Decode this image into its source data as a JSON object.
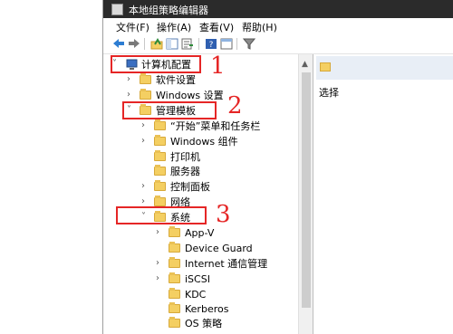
{
  "window": {
    "title": "本地组策略编辑器"
  },
  "menu": [
    {
      "label": "文件(F)"
    },
    {
      "label": "操作(A)"
    },
    {
      "label": "查看(V)"
    },
    {
      "label": "帮助(H)"
    }
  ],
  "toolbar": {
    "icons": [
      "back-arrow-icon",
      "forward-arrow-icon",
      "up-folder-icon",
      "show-hide-tree-icon",
      "export-list-icon",
      "help-icon",
      "properties-icon",
      "filter-icon"
    ]
  },
  "tree": {
    "nodes": [
      {
        "label": "计算机配置",
        "chevron": "down",
        "icon": "computer-icon"
      },
      {
        "label": "软件设置",
        "chevron": "right",
        "icon": "folder-icon"
      },
      {
        "label": "Windows 设置",
        "chevron": "right",
        "icon": "folder-icon"
      },
      {
        "label": "管理模板",
        "chevron": "down",
        "icon": "folder-icon"
      },
      {
        "label": "“开始”菜单和任务栏",
        "chevron": "right",
        "icon": "folder-icon"
      },
      {
        "label": "Windows 组件",
        "chevron": "right",
        "icon": "folder-icon"
      },
      {
        "label": "打印机",
        "chevron": "",
        "icon": "folder-icon"
      },
      {
        "label": "服务器",
        "chevron": "",
        "icon": "folder-icon"
      },
      {
        "label": "控制面板",
        "chevron": "right",
        "icon": "folder-icon"
      },
      {
        "label": "网络",
        "chevron": "right",
        "icon": "folder-icon"
      },
      {
        "label": "系统",
        "chevron": "down",
        "icon": "folder-icon"
      },
      {
        "label": "App-V",
        "chevron": "right",
        "icon": "folder-icon"
      },
      {
        "label": "Device Guard",
        "chevron": "",
        "icon": "folder-icon"
      },
      {
        "label": "Internet 通信管理",
        "chevron": "right",
        "icon": "folder-icon"
      },
      {
        "label": "iSCSI",
        "chevron": "right",
        "icon": "folder-icon"
      },
      {
        "label": "KDC",
        "chevron": "",
        "icon": "folder-icon"
      },
      {
        "label": "Kerberos",
        "chevron": "",
        "icon": "folder-icon"
      },
      {
        "label": "OS 策略",
        "chevron": "",
        "icon": "folder-icon"
      }
    ]
  },
  "right_pane": {
    "text": "选择"
  },
  "annotations": [
    {
      "number": "1"
    },
    {
      "number": "2"
    },
    {
      "number": "3"
    }
  ],
  "colors": {
    "titlebar": "#2b2b2b",
    "annotation": "#e52626",
    "folder": "#f4cf62"
  }
}
